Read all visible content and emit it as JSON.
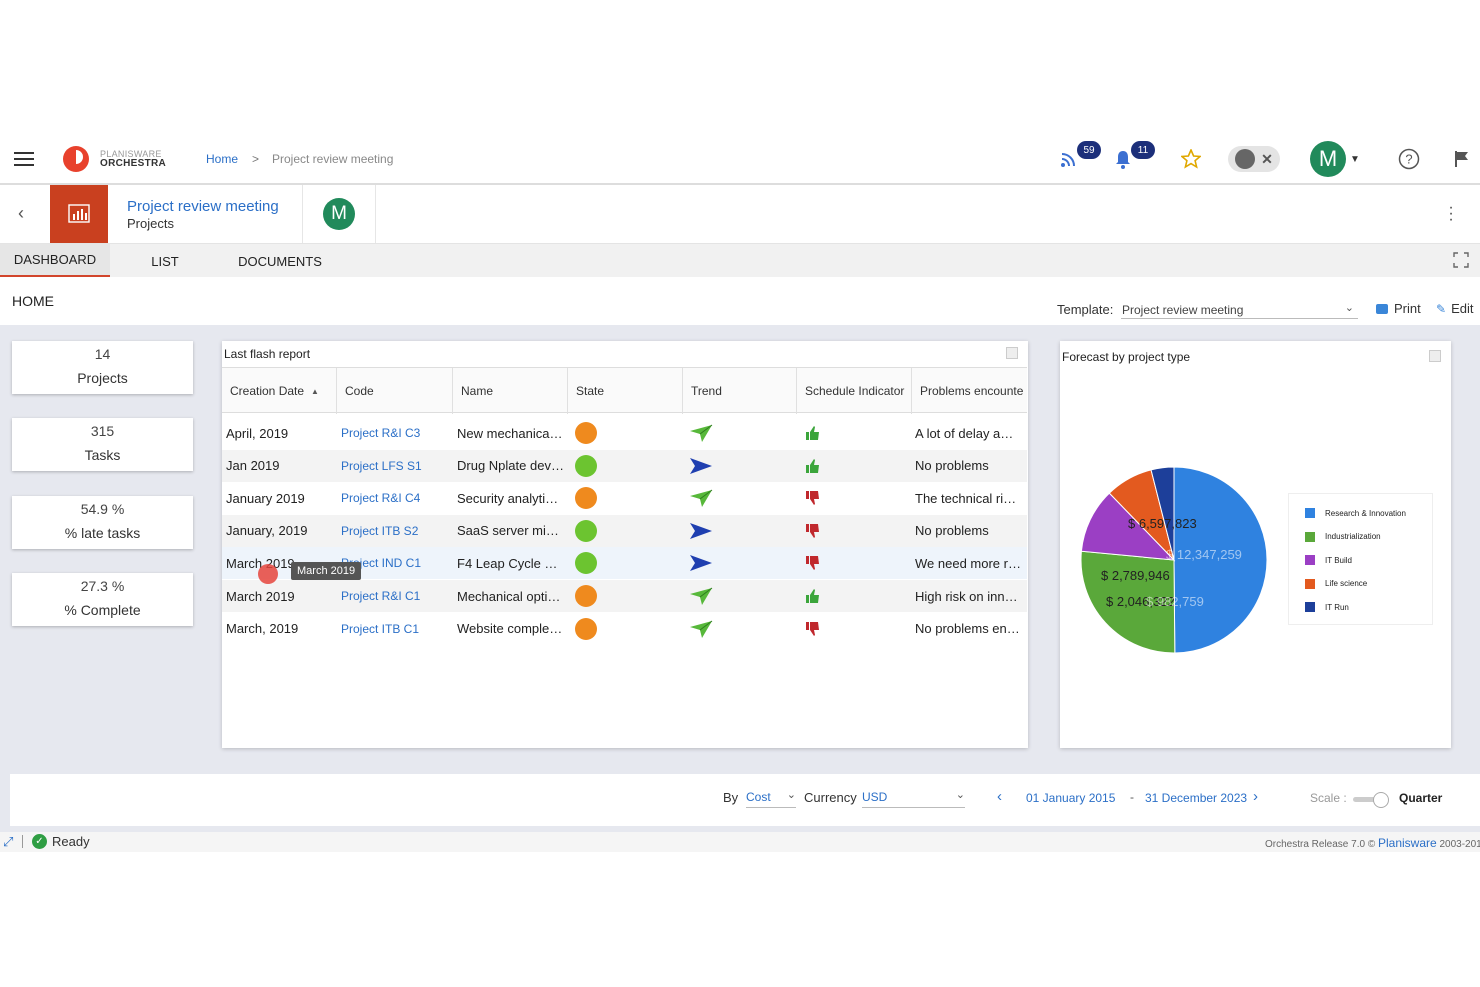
{
  "topbar": {
    "brand_top": "PLANISWARE",
    "brand_bottom": "ORCHESTRA",
    "breadcrumb": [
      {
        "label": "Home"
      },
      {
        "label": "Project review meeting"
      }
    ],
    "separator": ">",
    "rss_count": "59",
    "notif_count": "11",
    "avatar_letter": "M"
  },
  "header": {
    "title": "Project review meeting",
    "subtitle": "Projects",
    "avatar_letter": "M"
  },
  "tabs": [
    {
      "label": "DASHBOARD"
    },
    {
      "label": "LIST"
    },
    {
      "label": "DOCUMENTS"
    }
  ],
  "home": {
    "title": "HOME",
    "template_label": "Template:",
    "template_value": "Project review meeting",
    "print": "Print",
    "edit": "Edit"
  },
  "kpis": [
    {
      "value": "14",
      "label": "Projects"
    },
    {
      "value": "315",
      "label": "Tasks"
    },
    {
      "value": "54.9 %",
      "label": "% late tasks"
    },
    {
      "value": "27.3 %",
      "label": "% Complete"
    }
  ],
  "flash": {
    "title": "Last flash report",
    "columns": [
      "Creation Date",
      "Code",
      "Name",
      "State",
      "Trend",
      "Schedule Indicator",
      "Problems encounte"
    ],
    "rows": [
      {
        "date": "April, 2019",
        "code": "Project R&I C3",
        "name": "New mechanica…",
        "state": "orange",
        "trend": "up",
        "sched": "up",
        "problem": "A lot of delay a…"
      },
      {
        "date": "Jan 2019",
        "code": "Project LFS S1",
        "name": "Drug Nplate dev…",
        "state": "green",
        "trend": "flat",
        "sched": "up",
        "problem": "No problems"
      },
      {
        "date": "January 2019",
        "code": "Project R&I C4",
        "name": "Security analyti…",
        "state": "orange",
        "trend": "up",
        "sched": "down",
        "problem": "The technical ri…"
      },
      {
        "date": "January, 2019",
        "code": "Project ITB S2",
        "name": "SaaS server mi…",
        "state": "green",
        "trend": "flat",
        "sched": "down",
        "problem": "No problems"
      },
      {
        "date": "March 2019",
        "code": "Project IND C1",
        "name": "F4 Leap Cycle …",
        "state": "green",
        "trend": "flat",
        "sched": "down",
        "problem": "We need more r…"
      },
      {
        "date": "March 2019",
        "code": "Project R&I C1",
        "name": "Mechanical opti…",
        "state": "orange",
        "trend": "up",
        "sched": "up",
        "problem": "High risk on inn…"
      },
      {
        "date": "March, 2019",
        "code": "Project ITB C1",
        "name": "Website comple…",
        "state": "orange",
        "trend": "up",
        "sched": "down",
        "problem": "No problems en…"
      }
    ],
    "tooltip": "March 2019"
  },
  "forecast": {
    "title": "Forecast by project type"
  },
  "chart_data": {
    "type": "pie",
    "title": "Forecast by project type",
    "categories": [
      "Research & Innovation",
      "Industrialization",
      "IT Build",
      "Life science",
      "IT Run"
    ],
    "values": [
      12347259,
      6597823,
      2789946,
      2046322,
      982759
    ],
    "labels": [
      "$ 12,347,259",
      "$ 6,597,823",
      "$ 2,789,946",
      "$ 2,046,322",
      "$ 982,759"
    ],
    "colors": [
      "#2f82e0",
      "#5aa83a",
      "#9b3fc4",
      "#e35a1f",
      "#1d3f9a"
    ],
    "legend": "right"
  },
  "footer": {
    "by_label": "By",
    "by_value": "Cost",
    "currency_label": "Currency",
    "currency_value": "USD",
    "date_from": "01 January 2015",
    "date_sep": "-",
    "date_to": "31 December 2023",
    "scale_label": "Scale :",
    "scale_value": "Quarter"
  },
  "status": {
    "ready": "Ready",
    "release": "Orchestra Release 7.0 ©",
    "company": "Planisware",
    "years": "2003-201"
  }
}
